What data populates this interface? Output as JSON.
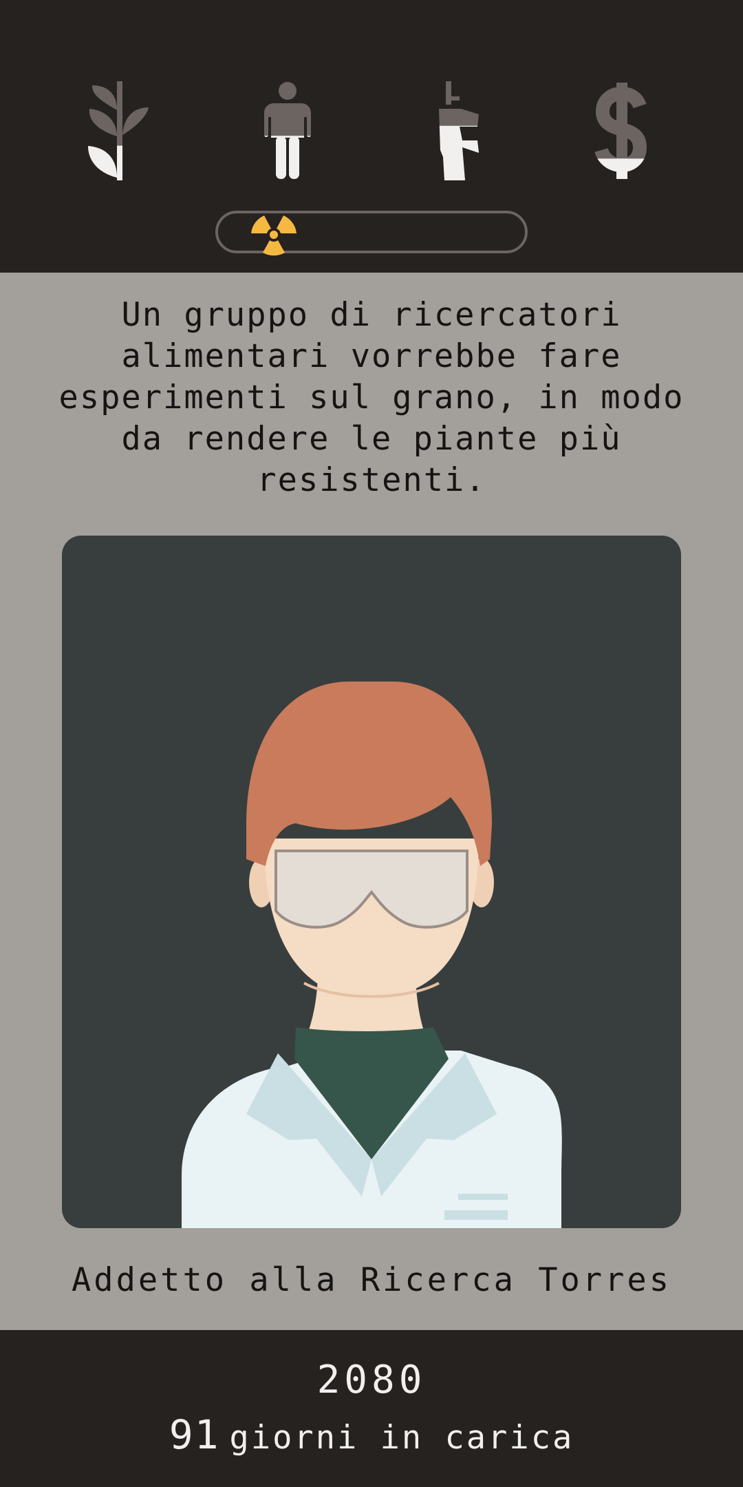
{
  "stats": [
    {
      "name": "Natura",
      "icon": "plant-icon",
      "level": 0.35
    },
    {
      "name": "Popolazione",
      "icon": "person-icon",
      "level": 0.45
    },
    {
      "name": "Armi",
      "icon": "rifle-icon",
      "level": 0.55
    },
    {
      "name": "Denaro",
      "icon": "dollar-icon",
      "level": 0.22
    }
  ],
  "progress": {
    "icon": "radiation-hazard-icon",
    "level": 0.18
  },
  "question": "Un gruppo di ricercatori alimentari vorrebbe fare esperimenti sul grano, in modo da rendere le piante più resistenti.",
  "speaker": "Addetto alla Ricerca Torres",
  "footer": {
    "year": "2080",
    "days_number": "91",
    "days_label": "giorni in carica"
  },
  "colors": {
    "topbar": "#252220",
    "background": "#a39f9b",
    "icon_empty": "#6b6460",
    "icon_fill": "#f2f0ee",
    "hazard": "#f5b942",
    "card": "#383e3d",
    "hair": "#c97b5c",
    "skin": "#f5dcc5"
  }
}
